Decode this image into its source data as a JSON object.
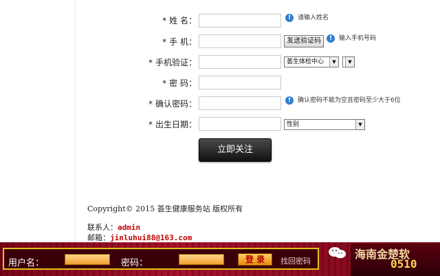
{
  "form": {
    "required_mark": "*",
    "name_label": "姓 名：",
    "name_hint": "请输入姓名",
    "phone_label": "手 机：",
    "send_code_button": "发送验证码",
    "phone_hint": "输入手机号码",
    "verify_label": "手机验证：",
    "center_select": "荟生体检中心",
    "password_label": "密 码：",
    "confirm_label": "确认密码：",
    "confirm_hint": "确认密码不能为空且密码至少大于6位",
    "birth_label": "出生日期：",
    "gender_select": "性别",
    "submit_button": "立即关注"
  },
  "footer": {
    "copyright": "Copyright© 2015 荟生健康服务站 版权所有",
    "contact_label": "联系人：",
    "contact_value": "admin",
    "email_label": "邮箱：",
    "email_value": "jinluhui88@163.com"
  },
  "login_bar": {
    "username_label": "用户名：",
    "password_label": "密码：",
    "login_button": "登 录",
    "forgot_link": "找回密码"
  },
  "brand": {
    "text_top": "海南金楚软",
    "text_bottom": "0510"
  },
  "colors": {
    "info_icon": "#2f7fd0",
    "login_bar": "#a8122d",
    "accent_gold": "#e8c020"
  }
}
